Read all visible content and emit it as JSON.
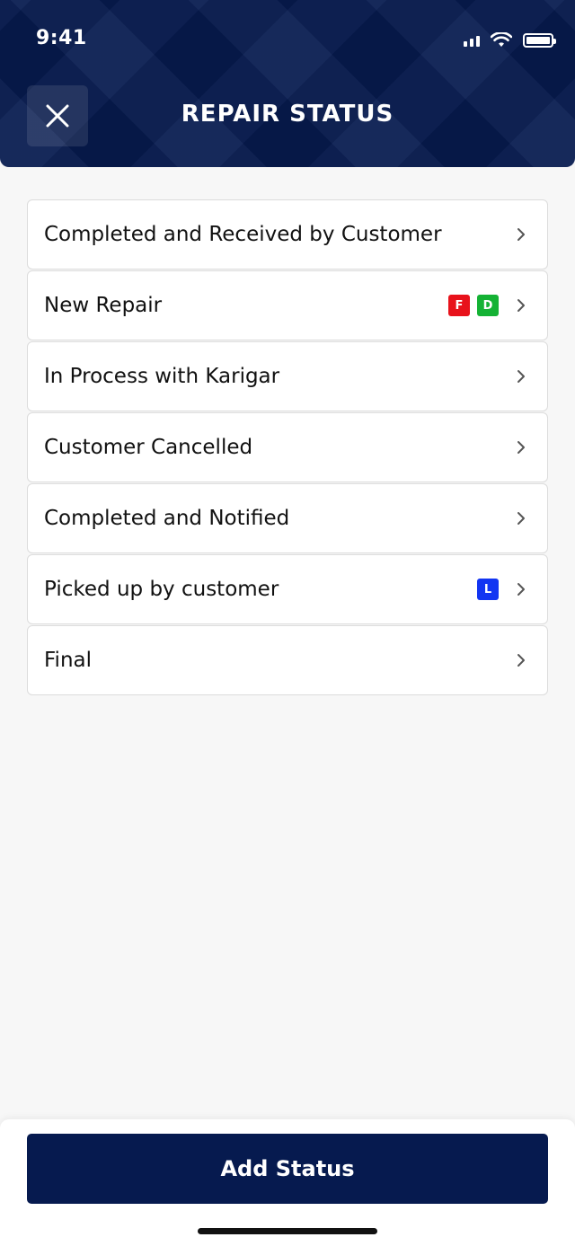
{
  "status_bar": {
    "time": "9:41"
  },
  "header": {
    "title": "REPAIR STATUS",
    "close_icon": "close-icon"
  },
  "colors": {
    "header_bg": "#061a4f",
    "badge_red": "#e8121b",
    "badge_green": "#14b234",
    "badge_blue": "#1235f2",
    "primary_button": "#061a4f"
  },
  "statuses": [
    {
      "label": "Completed and Received by Customer",
      "badges": []
    },
    {
      "label": "New Repair",
      "badges": [
        {
          "text": "F",
          "color": "#e8121b"
        },
        {
          "text": "D",
          "color": "#14b234"
        }
      ]
    },
    {
      "label": "In Process with Karigar",
      "badges": []
    },
    {
      "label": "Customer Cancelled",
      "badges": []
    },
    {
      "label": "Completed and Notified",
      "badges": []
    },
    {
      "label": "Picked up by customer",
      "badges": [
        {
          "text": "L",
          "color": "#1235f2"
        }
      ]
    },
    {
      "label": "Final",
      "badges": []
    }
  ],
  "footer": {
    "add_button_label": "Add Status"
  }
}
